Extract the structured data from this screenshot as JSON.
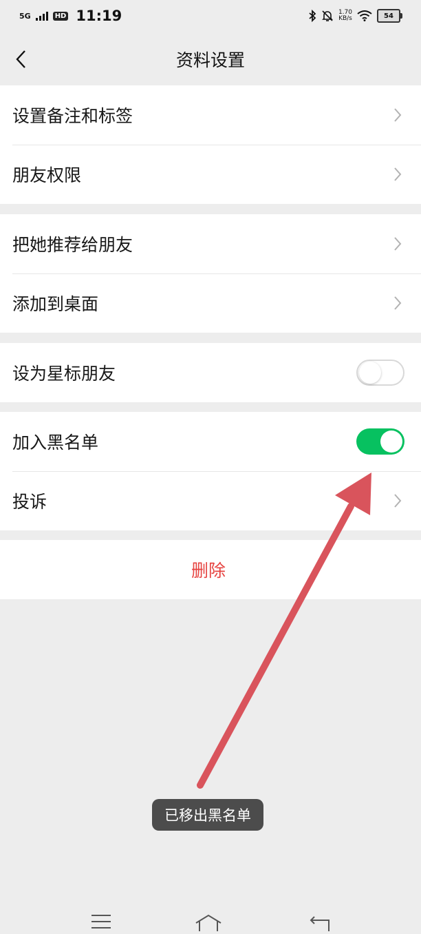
{
  "status_bar": {
    "network": "5G",
    "hd": "HD",
    "time": "11:19",
    "net_speed_value": "1.70",
    "net_speed_unit": "KB/s",
    "battery": "54",
    "icons": [
      "bluetooth-icon",
      "mute-bell-icon",
      "wifi-icon",
      "battery-icon"
    ]
  },
  "header": {
    "title": "资料设置",
    "back_icon": "chevron-left-icon"
  },
  "groups": [
    {
      "items": [
        {
          "label": "设置备注和标签",
          "type": "link"
        },
        {
          "label": "朋友权限",
          "type": "link"
        }
      ]
    },
    {
      "items": [
        {
          "label": "把她推荐给朋友",
          "type": "link"
        },
        {
          "label": "添加到桌面",
          "type": "link"
        }
      ]
    },
    {
      "items": [
        {
          "label": "设为星标朋友",
          "type": "toggle",
          "on": false
        }
      ]
    },
    {
      "items": [
        {
          "label": "加入黑名单",
          "type": "toggle",
          "on": true
        },
        {
          "label": "投诉",
          "type": "link"
        }
      ]
    }
  ],
  "delete_label": "删除",
  "toast": "已移出黑名单",
  "colors": {
    "accent_green": "#07c160",
    "danger_red": "#e64340",
    "annotation_arrow": "#d9545c",
    "background": "#ededed"
  },
  "system_nav": [
    "menu-icon",
    "home-icon",
    "back-icon"
  ]
}
